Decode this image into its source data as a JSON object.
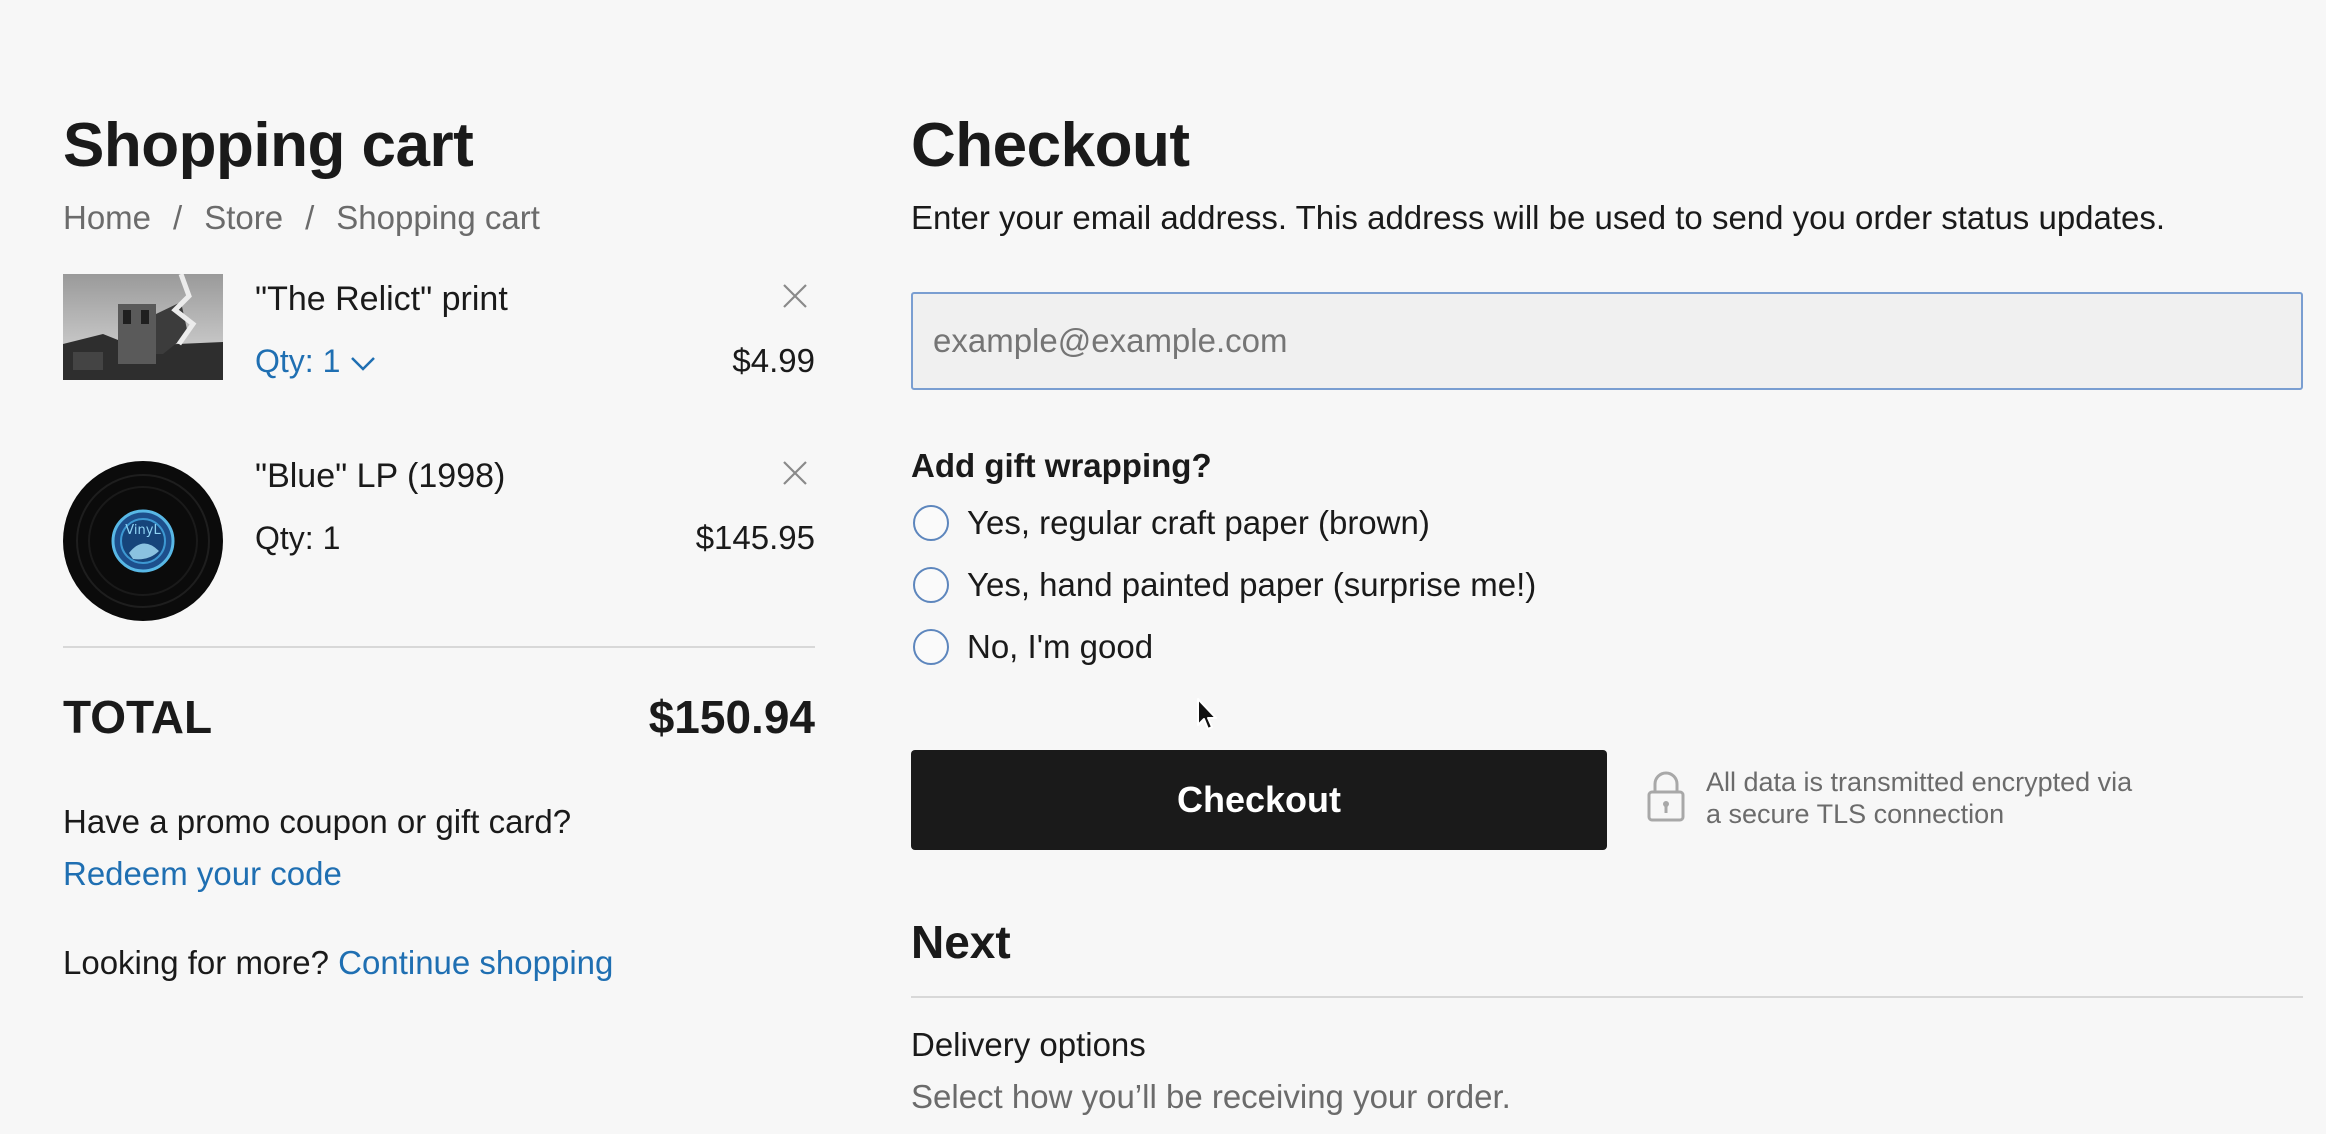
{
  "cart": {
    "title": "Shopping cart",
    "breadcrumb": [
      "Home",
      "Store",
      "Shopping cart"
    ],
    "items": [
      {
        "name": "\"The Relict\" print",
        "qty": "Qty: 1",
        "price": "$4.99",
        "qty_dropdown": true
      },
      {
        "name": "\"Blue\" LP (1998)",
        "qty": "Qty: 1",
        "price": "$145.95",
        "qty_dropdown": false,
        "thumb_label": "VinyL"
      }
    ],
    "total_label": "TOTAL",
    "total_value": "$150.94",
    "promo_prompt": "Have a promo coupon or gift card?",
    "promo_link": "Redeem your code",
    "more_prompt": "Looking for more?",
    "more_link": "Continue shopping"
  },
  "checkout": {
    "title": "Checkout",
    "intro": "Enter your email address. This address will be used to send you order status updates.",
    "email_placeholder": "example@example.com",
    "gift_title": "Add gift wrapping?",
    "gift_options": [
      "Yes, regular craft paper (brown)",
      "Yes, hand painted paper (surprise me!)",
      "No, I'm good"
    ],
    "button_label": "Checkout",
    "secure_line1": "All data is transmitted encrypted via",
    "secure_line2": "a secure TLS connection",
    "next_title": "Next",
    "delivery_title": "Delivery options",
    "delivery_subtitle": "Select how you’ll be receiving your order."
  },
  "colors": {
    "link": "#1f6fb2",
    "button_bg": "#1a1a1a",
    "input_border": "#7a9ed1",
    "background": "#f7f7f7"
  },
  "icons": [
    "close-icon",
    "chevron-down-icon",
    "lock-icon",
    "mouse-cursor-icon"
  ]
}
